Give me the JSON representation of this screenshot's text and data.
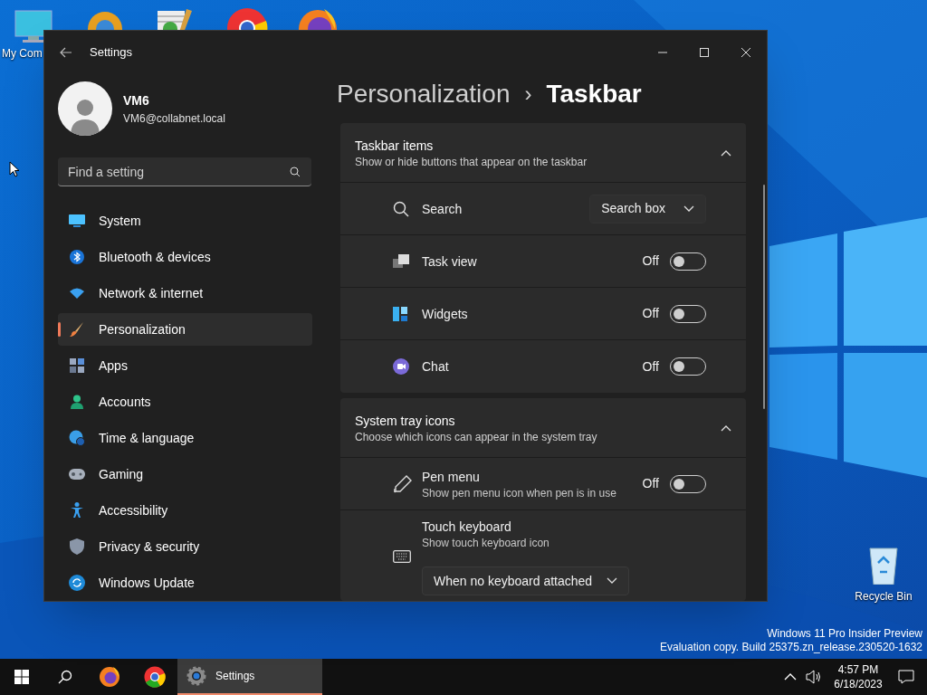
{
  "desktop": {
    "icons": [
      {
        "label": "My Com"
      },
      {
        "label": "Recycle Bin"
      }
    ],
    "notice": [
      "Windows 11 Pro Insider Preview",
      "Evaluation copy. Build 25375.zn_release.230520-1632"
    ]
  },
  "window": {
    "title": "Settings",
    "user": {
      "name": "VM6",
      "email": "VM6@collabnet.local"
    },
    "search": {
      "placeholder": "Find a setting"
    },
    "nav": [
      {
        "label": "System",
        "selected": false
      },
      {
        "label": "Bluetooth & devices",
        "selected": false
      },
      {
        "label": "Network & internet",
        "selected": false
      },
      {
        "label": "Personalization",
        "selected": true
      },
      {
        "label": "Apps",
        "selected": false
      },
      {
        "label": "Accounts",
        "selected": false
      },
      {
        "label": "Time & language",
        "selected": false
      },
      {
        "label": "Gaming",
        "selected": false
      },
      {
        "label": "Accessibility",
        "selected": false
      },
      {
        "label": "Privacy & security",
        "selected": false
      },
      {
        "label": "Windows Update",
        "selected": false
      }
    ],
    "breadcrumb": {
      "parent": "Personalization",
      "separator": "›",
      "current": "Taskbar"
    },
    "sections": [
      {
        "title": "Taskbar items",
        "subtitle": "Show or hide buttons that appear on the taskbar",
        "expanded": true,
        "items": [
          {
            "kind": "dropdown",
            "label": "Search",
            "value": "Search box"
          },
          {
            "kind": "toggle",
            "label": "Task view",
            "state_label": "Off",
            "on": false
          },
          {
            "kind": "toggle",
            "label": "Widgets",
            "state_label": "Off",
            "on": false
          },
          {
            "kind": "toggle",
            "label": "Chat",
            "state_label": "Off",
            "on": false
          }
        ]
      },
      {
        "title": "System tray icons",
        "subtitle": "Choose which icons can appear in the system tray",
        "expanded": true,
        "items": [
          {
            "kind": "toggle",
            "label": "Pen menu",
            "description": "Show pen menu icon when pen is in use",
            "state_label": "Off",
            "on": false
          },
          {
            "kind": "dropdown_below",
            "label": "Touch keyboard",
            "description": "Show touch keyboard icon",
            "value": "When no keyboard attached"
          }
        ]
      }
    ]
  },
  "taskbar": {
    "apps": [
      {
        "label": "Settings",
        "active": true
      }
    ],
    "clock": {
      "time": "4:57 PM",
      "date": "6/18/2023"
    }
  }
}
